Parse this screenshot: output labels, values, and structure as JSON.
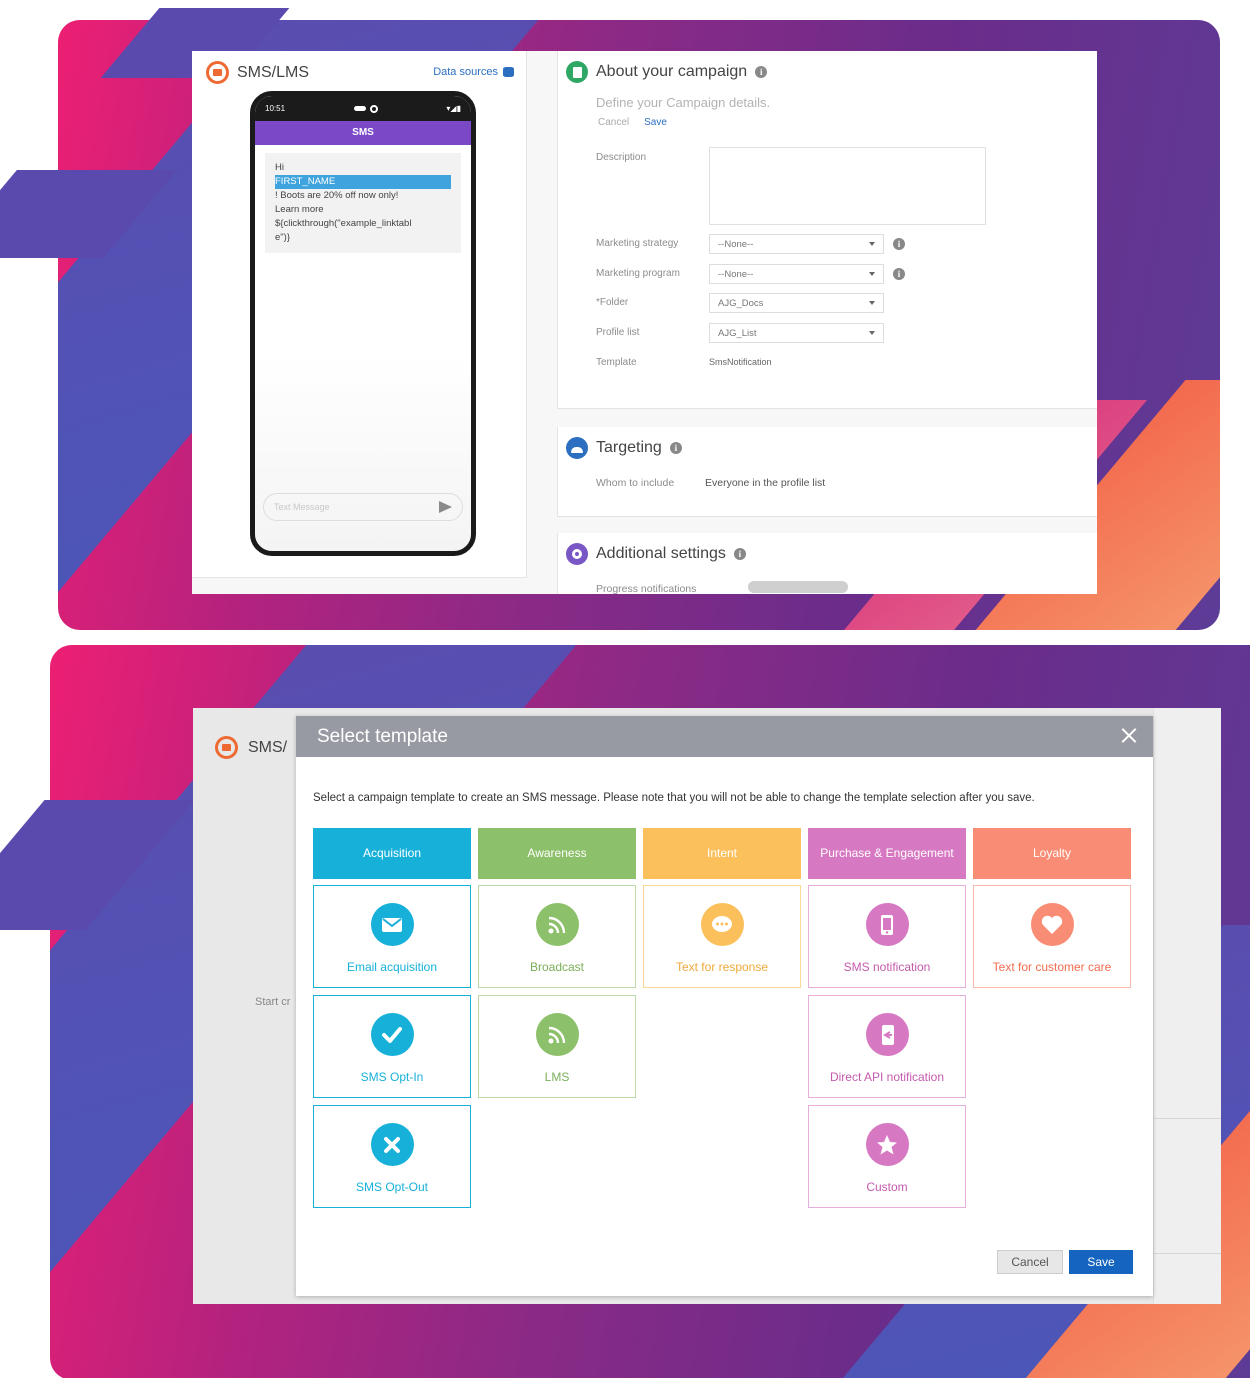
{
  "colors": {
    "acquisition": "#17b0d9",
    "awareness": "#8dc06a",
    "intent": "#fbc05b",
    "purchase": "#d779c2",
    "loyalty": "#f98c74",
    "link_blue": "#2c6fc1",
    "save_blue": "#1565c0"
  },
  "screen1": {
    "panel_title": "SMS/LMS",
    "data_sources": "Data sources",
    "phone": {
      "time": "10:51",
      "bar_title": "SMS",
      "msg_line1": "Hi",
      "msg_highlight": "FIRST_NAME",
      "msg_line2": "! Boots are 20% off now only!",
      "msg_line3": "Learn more",
      "msg_line4": "${clickthrough(\"example_linktabl",
      "msg_line5": "e\")}",
      "input_placeholder": "Text Message"
    },
    "about": {
      "title": "About your campaign",
      "subtitle": "Define your Campaign details.",
      "cancel": "Cancel",
      "save": "Save",
      "fields": {
        "description": "Description",
        "marketing_strategy_label": "Marketing strategy",
        "marketing_strategy_value": "--None--",
        "marketing_program_label": "Marketing program",
        "marketing_program_value": "--None--",
        "folder_label": "*Folder",
        "folder_value": "AJG_Docs",
        "profile_list_label": "Profile list",
        "profile_list_value": "AJG_List",
        "template_label": "Template",
        "template_value": "SmsNotification"
      }
    },
    "targeting": {
      "title": "Targeting",
      "whom_label": "Whom to include",
      "whom_value": "Everyone in the profile list"
    },
    "additional": {
      "title": "Additional settings",
      "progress_label": "Progress notifications"
    }
  },
  "screen2": {
    "underlying_title": "SMS/",
    "underlying_start": "Start cr",
    "modal": {
      "title": "Select template",
      "description": "Select a campaign template to create an SMS message. Please note that you will not be able to change the template selection after you save.",
      "categories": [
        "Acquisition",
        "Awareness",
        "Intent",
        "Purchase & Engagement",
        "Loyalty"
      ],
      "tiles": {
        "email_acquisition": "Email acquisition",
        "broadcast": "Broadcast",
        "text_for_response": "Text for response",
        "sms_notification": "SMS notification",
        "text_for_customer_care": "Text for customer care",
        "sms_opt_in": "SMS Opt-In",
        "lms": "LMS",
        "direct_api_notification": "Direct API notification",
        "sms_opt_out": "SMS Opt-Out",
        "custom": "Custom"
      },
      "cancel": "Cancel",
      "save": "Save"
    }
  }
}
